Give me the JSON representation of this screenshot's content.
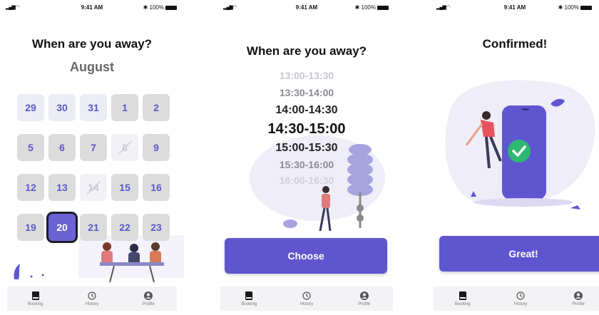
{
  "status": {
    "time": "9:41 AM",
    "battery": "100%"
  },
  "screen1": {
    "title": "When are you away?",
    "month": "August",
    "days": [
      {
        "label": "29",
        "state": "light"
      },
      {
        "label": "30",
        "state": "light"
      },
      {
        "label": "31",
        "state": "light"
      },
      {
        "label": "1",
        "state": "normal"
      },
      {
        "label": "2",
        "state": "normal"
      },
      {
        "label": "5",
        "state": "normal"
      },
      {
        "label": "6",
        "state": "normal"
      },
      {
        "label": "7",
        "state": "normal"
      },
      {
        "label": "8",
        "state": "disabled"
      },
      {
        "label": "9",
        "state": "normal"
      },
      {
        "label": "12",
        "state": "normal"
      },
      {
        "label": "13",
        "state": "normal"
      },
      {
        "label": "14",
        "state": "disabled"
      },
      {
        "label": "15",
        "state": "normal"
      },
      {
        "label": "16",
        "state": "normal"
      },
      {
        "label": "19",
        "state": "normal"
      },
      {
        "label": "20",
        "state": "selected"
      },
      {
        "label": "21",
        "state": "normal"
      },
      {
        "label": "22",
        "state": "normal"
      },
      {
        "label": "23",
        "state": "normal"
      }
    ]
  },
  "screen2": {
    "title": "When are you away?",
    "times": [
      "13:00-13:30",
      "13:30-14:00",
      "14:00-14:30",
      "14:30-15:00",
      "15:00-15:30",
      "15:30-16:00",
      "16:00-16:30"
    ],
    "button": "Choose"
  },
  "screen3": {
    "title": "Confirmed!",
    "button": "Great!"
  },
  "tabs": [
    {
      "label": "Booking",
      "icon": "book-icon"
    },
    {
      "label": "History",
      "icon": "history-icon"
    },
    {
      "label": "Profile",
      "icon": "profile-icon"
    }
  ],
  "colors": {
    "accent": "#5f56cf",
    "day_text": "#5a5ac8",
    "day_bg": "#dcdcdc"
  }
}
